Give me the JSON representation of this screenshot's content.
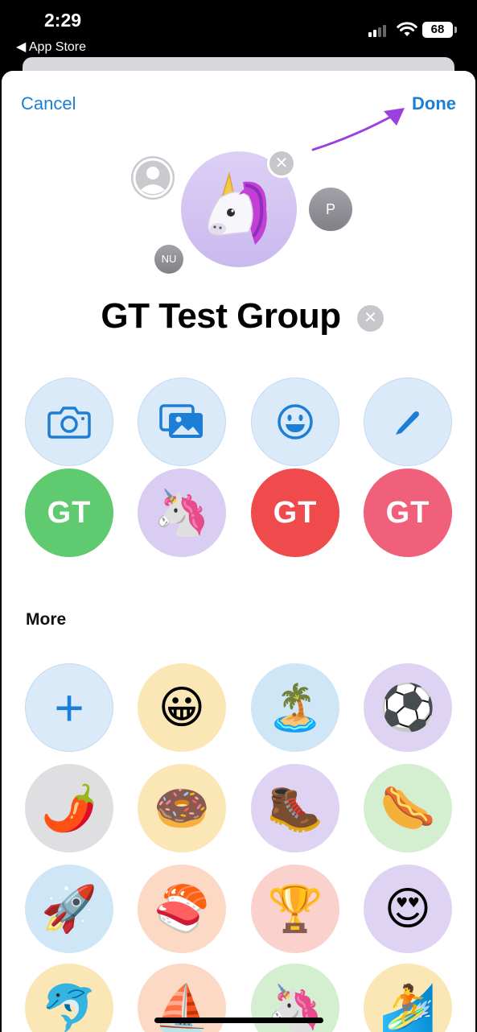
{
  "status_bar": {
    "time": "2:29",
    "back_label": "App Store",
    "battery": "68"
  },
  "header": {
    "cancel_label": "Cancel",
    "done_label": "Done"
  },
  "avatars": {
    "remove_symbol": "✕",
    "p_initial": "P",
    "nu_initials": "NU"
  },
  "group": {
    "name": "GT Test Group",
    "clear_symbol": "✕"
  },
  "options": [
    {
      "icon": "camera-icon"
    },
    {
      "icon": "photos-icon"
    },
    {
      "icon": "emoji-icon"
    },
    {
      "icon": "pencil-icon"
    }
  ],
  "suggestions": [
    {
      "label": "GT",
      "color": "#5fca6f"
    },
    {
      "label": "🦄",
      "color": "#d9cdf2"
    },
    {
      "label": "GT",
      "color": "#ef4a4c"
    },
    {
      "label": "GT",
      "color": "#f0607a"
    }
  ],
  "more": {
    "title": "More",
    "add_symbol": "+",
    "items": [
      {
        "emoji": "😀",
        "bg": "#fbe6b5"
      },
      {
        "emoji": "🏝️",
        "bg": "#cfe6f7"
      },
      {
        "emoji": "⚽",
        "bg": "#dfd3f3"
      },
      {
        "emoji": "🌶️",
        "bg": "#dfdfe1"
      },
      {
        "emoji": "🍩",
        "bg": "#fbe6b5"
      },
      {
        "emoji": "🥾",
        "bg": "#dfd3f3"
      },
      {
        "emoji": "🌭",
        "bg": "#d3efcf"
      },
      {
        "emoji": "🚀",
        "bg": "#cfe6f7"
      },
      {
        "emoji": "🍣",
        "bg": "#fcd9c4"
      },
      {
        "emoji": "🏆",
        "bg": "#fad1cd"
      },
      {
        "emoji": "😍",
        "bg": "#dfd3f3"
      },
      {
        "emoji": "🐬",
        "bg": "#fbe6b5"
      },
      {
        "emoji": "⛵",
        "bg": "#fcd9c4"
      },
      {
        "emoji": "🦄",
        "bg": "#d3efcf"
      },
      {
        "emoji": "🏄",
        "bg": "#fbe6b5"
      }
    ]
  },
  "colors": {
    "accent": "#1d7ed6",
    "arrow": "#9b3fe0"
  }
}
